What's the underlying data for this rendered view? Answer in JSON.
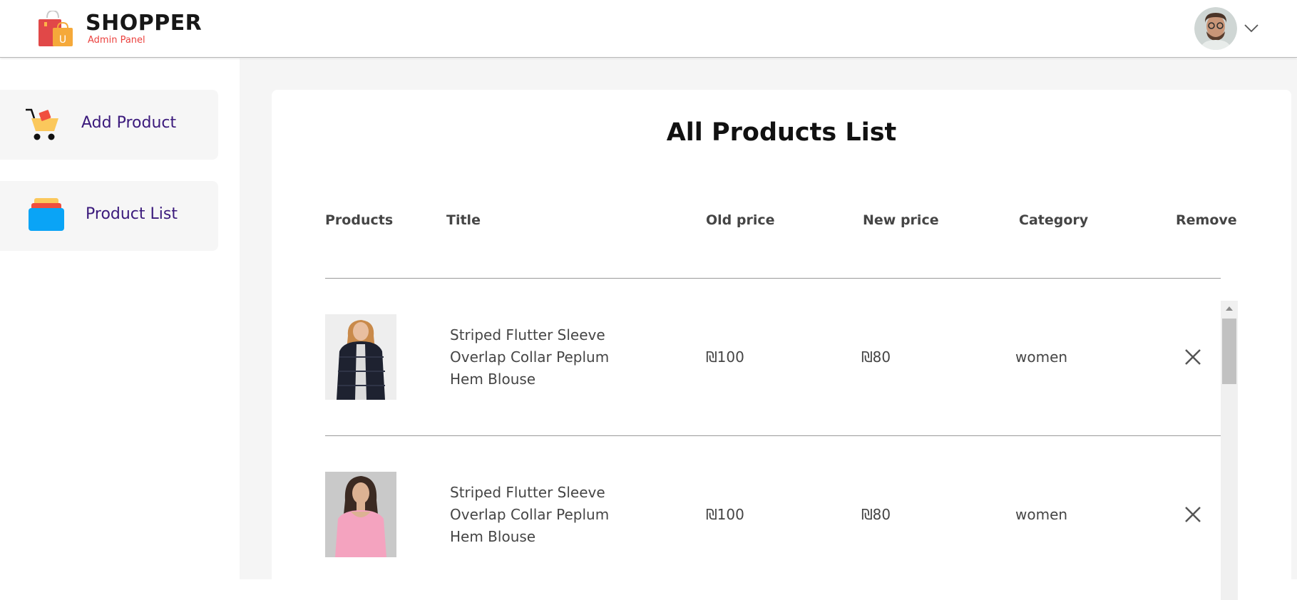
{
  "navbar": {
    "brand_name": "SHOPPER",
    "brand_subtitle": "Admin Panel",
    "bag_letter": "U"
  },
  "sidebar": {
    "items": [
      {
        "label": "Add Product",
        "icon": "cart-icon"
      },
      {
        "label": "Product List",
        "icon": "stack-icon"
      }
    ]
  },
  "main": {
    "title": "All Products List",
    "columns": [
      "Products",
      "Title",
      "Old price",
      "New price",
      "Category",
      "Remove"
    ],
    "rows": [
      {
        "title_lines": [
          "Striped Flutter Sleeve",
          "Overlap Collar Peplum",
          "Hem Blouse"
        ],
        "old_price": "₪100",
        "new_price": "₪80",
        "category": "women"
      },
      {
        "title_lines": [
          "Striped Flutter Sleeve",
          "Overlap Collar Peplum",
          "Hem Blouse"
        ],
        "old_price": "₪100",
        "new_price": "₪80",
        "category": "women"
      }
    ]
  },
  "colors": {
    "brand_red": "#eb423f",
    "sidebar_label": "#3b1a7c",
    "main_bg": "#f5f5f5"
  }
}
